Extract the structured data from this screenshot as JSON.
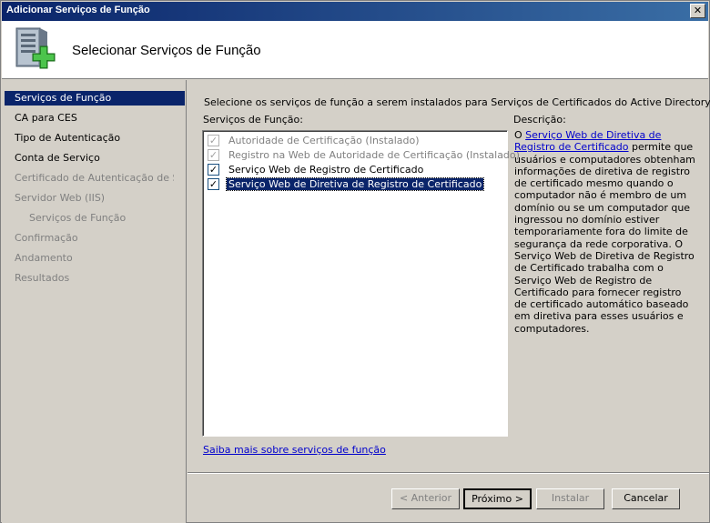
{
  "window": {
    "title": "Adicionar Serviços de Função",
    "close_glyph": "✕"
  },
  "header": {
    "heading": "Selecionar Serviços de Função",
    "icon": "server-add-icon"
  },
  "sidebar": {
    "items": [
      {
        "label": "Serviços de Função",
        "state": "active"
      },
      {
        "label": "CA para CES",
        "state": "normal"
      },
      {
        "label": "Tipo de Autenticação",
        "state": "normal"
      },
      {
        "label": "Conta de Serviço",
        "state": "normal"
      },
      {
        "label": "Certificado de Autenticação de S...",
        "state": "disabled"
      },
      {
        "label": "Servidor Web (IIS)",
        "state": "disabled"
      },
      {
        "label": "Serviços de Função",
        "state": "disabled-sub"
      },
      {
        "label": "Confirmação",
        "state": "disabled"
      },
      {
        "label": "Andamento",
        "state": "disabled"
      },
      {
        "label": "Resultados",
        "state": "disabled"
      }
    ]
  },
  "main": {
    "instruction": "Selecione os serviços de função a serem instalados para Serviços de Certificados do Active Directory:",
    "list_label": "Serviços de Função:",
    "description_label": "Descrição:",
    "services": [
      {
        "label": "Autoridade de Certificação  (Instalado)",
        "checked": true,
        "enabled": false,
        "selected": false
      },
      {
        "label": "Registro na Web de Autoridade de Certificação  (Instalado)",
        "checked": true,
        "enabled": false,
        "selected": false
      },
      {
        "label": "Serviço Web de Registro de Certificado",
        "checked": true,
        "enabled": true,
        "selected": false
      },
      {
        "label": "Serviço Web de Diretiva de Registro de Certificado",
        "checked": true,
        "enabled": true,
        "selected": true
      }
    ],
    "description": {
      "prefix": "O ",
      "link": "Serviço Web de Diretiva de Registro de Certificado",
      "body": " permite que usuários e computadores obtenham informações de diretiva de registro de certificado mesmo quando o computador não é membro de um domínio ou se um computador que ingressou no domínio estiver temporariamente fora do limite de segurança da rede corporativa. O Serviço Web de Diretiva de Registro de Certificado trabalha com o Serviço Web de Registro de Certificado para fornecer registro de certificado automático baseado em diretiva para esses usuários e computadores."
    },
    "learn_more": "Saiba mais sobre serviços de função"
  },
  "buttons": {
    "back": "< Anterior",
    "next": "Próximo >",
    "install": "Instalar",
    "cancel": "Cancelar"
  },
  "colors": {
    "selection": "#0a246a",
    "link": "#0000cc",
    "face": "#d4d0c8"
  }
}
